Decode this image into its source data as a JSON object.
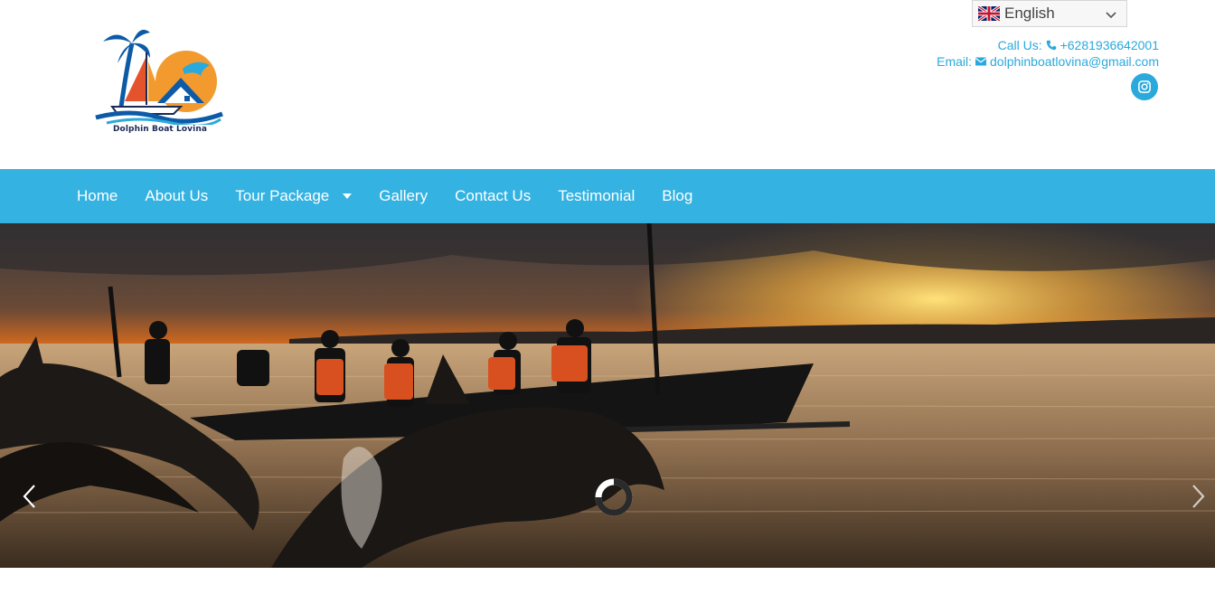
{
  "header": {
    "logo_text": "Dolphin Boat Lovina",
    "language": {
      "selected": "English",
      "flag_icon": "uk-flag-icon"
    },
    "contact": {
      "call_label": "Call Us:",
      "phone": "+6281936642001",
      "email_label": "Email:",
      "email": "dolphinboatlovina@gmail.com"
    },
    "social": {
      "instagram_icon": "instagram-icon"
    }
  },
  "nav": {
    "items": [
      {
        "label": "Home"
      },
      {
        "label": "About Us"
      },
      {
        "label": "Tour Package",
        "has_dropdown": true
      },
      {
        "label": "Gallery"
      },
      {
        "label": "Contact Us"
      },
      {
        "label": "Testimonial"
      },
      {
        "label": "Blog"
      }
    ]
  },
  "hero": {
    "image": "sunset-dolphins-boat-photo",
    "prev_icon": "chevron-left-icon",
    "next_icon": "chevron-right-icon",
    "loading_icon": "loading-spinner-icon"
  },
  "colors": {
    "accent": "#34b2e2",
    "link": "#2aa9dc"
  }
}
